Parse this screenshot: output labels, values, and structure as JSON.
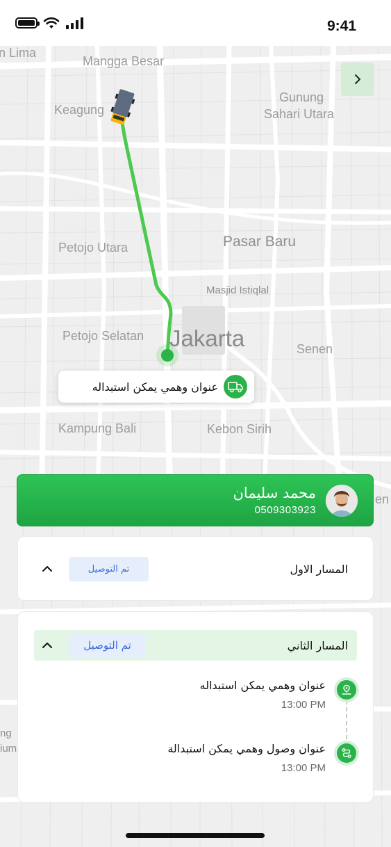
{
  "status_bar": {
    "time": "9:41"
  },
  "map": {
    "labels": {
      "lima": "n Lima",
      "mangga_besar": "Mangga Besar",
      "gunung_sahari_1": "Gunung",
      "gunung_sahari_2": "Sahari Utara",
      "keagung": "Keagung",
      "petojo_utara": "Petojo Utara",
      "pasar_baru": "Pasar Baru",
      "masjid_istiqlal": "Masjid Istiqlal",
      "petojo_selatan": "Petojo Selatan",
      "jakarta": "Jakarta",
      "senen": "Senen",
      "kampung_bali": "Kampung Bali",
      "kebon_sirih": "Kebon Sirih",
      "edge_ng": "ng",
      "edge_ium": "ium",
      "edge_en": "en"
    },
    "callout_address": "عنوان وهمي يمكن استبداله"
  },
  "driver": {
    "name": "محمد سليمان",
    "phone": "0509303923"
  },
  "routes": [
    {
      "title": "المسار الاول",
      "status": "تم التوصيل"
    },
    {
      "title": "المسار الثاني",
      "status": "تم التوصيل",
      "stops": [
        {
          "address": "عنوان وهمي يمكن استبداله",
          "time": "13:00 PM"
        },
        {
          "address": "عنوان وصول وهمي يمكن استبدالة",
          "time": "13:00 PM"
        }
      ]
    }
  ],
  "colors": {
    "primary_green": "#2bb24a",
    "status_blue": "#3b6edb",
    "status_badge_bg": "#e6eefb",
    "route_line": "#4cc94e"
  },
  "icons": {
    "battery": "battery-icon",
    "wifi": "wifi-icon",
    "signal": "signal-icon",
    "collapse": "chevron-right-icon",
    "truck": "truck-icon",
    "chevron_up": "chevron-up-icon",
    "pickup": "pin-route-icon",
    "dropoff": "route-icon"
  }
}
